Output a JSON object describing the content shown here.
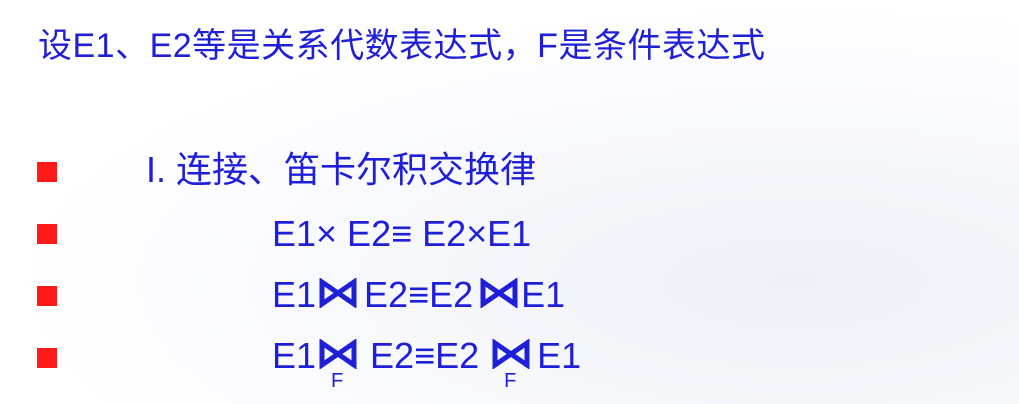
{
  "slide": {
    "title": "设E1、E2等是关系代数表达式，F是条件表达式",
    "bullet_color": "#ff1a1a",
    "text_color": "#1f1fd8",
    "lines": [
      {
        "text": "I. 连接、笛卡尔积交换律"
      },
      {
        "left": "E1× E2≡ E2×E1"
      },
      {
        "left": "E1",
        "right_a": "E2≡E2",
        "right_b": "E1"
      },
      {
        "left": "E1",
        "sub1": "F",
        "right_a": "E2≡E2",
        "sub2": "F",
        "right_b": "E1"
      }
    ],
    "icons": [
      "bullet-square",
      "join-bowtie-icon",
      "theta-join-bowtie-icon"
    ]
  }
}
